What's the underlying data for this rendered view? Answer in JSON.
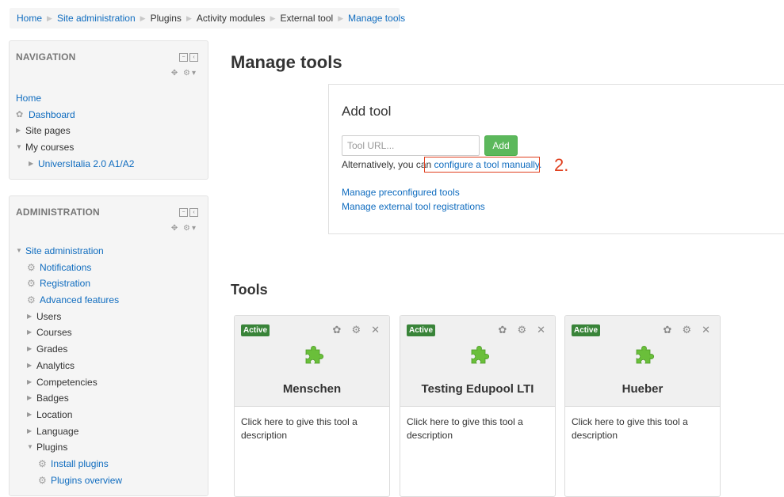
{
  "breadcrumb": [
    {
      "label": "Home",
      "link": true
    },
    {
      "label": "Site administration",
      "link": true
    },
    {
      "label": "Plugins",
      "link": false
    },
    {
      "label": "Activity modules",
      "link": false
    },
    {
      "label": "External tool",
      "link": false
    },
    {
      "label": "Manage tools",
      "link": true
    }
  ],
  "navigation": {
    "title": "NAVIGATION",
    "home": "Home",
    "dashboard": "Dashboard",
    "site_pages": "Site pages",
    "my_courses": "My courses",
    "course": "UniversItalia 2.0 A1/A2"
  },
  "administration": {
    "title": "ADMINISTRATION",
    "site_admin": "Site administration",
    "notifications": "Notifications",
    "registration": "Registration",
    "advanced_features": "Advanced features",
    "users": "Users",
    "courses": "Courses",
    "grades": "Grades",
    "analytics": "Analytics",
    "competencies": "Competencies",
    "badges": "Badges",
    "location": "Location",
    "language": "Language",
    "plugins": "Plugins",
    "install_plugins": "Install plugins",
    "plugins_overview": "Plugins overview"
  },
  "main": {
    "title": "Manage tools",
    "add_tool": {
      "heading": "Add tool",
      "url_placeholder": "Tool URL...",
      "add_button": "Add",
      "alt_prefix": "Alternatively, you can ",
      "configure_link": "configure a tool manually.",
      "step_number": "2.",
      "manage_preconfigured": "Manage preconfigured tools",
      "manage_registrations": "Manage external tool registrations"
    },
    "tools_heading": "Tools",
    "tools": [
      {
        "status": "Active",
        "name": "Menschen",
        "description": "Click here to give this tool a description"
      },
      {
        "status": "Active",
        "name": "Testing Edupool LTI",
        "description": "Click here to give this tool a description"
      },
      {
        "status": "Active",
        "name": "Hueber",
        "description": "Click here to give this tool a description"
      }
    ]
  },
  "colors": {
    "link": "#0f6cbf",
    "add_button": "#5cb85c",
    "active_badge": "#398439",
    "annotation": "#e0401f",
    "puzzle_icon": "#6abf3a"
  }
}
